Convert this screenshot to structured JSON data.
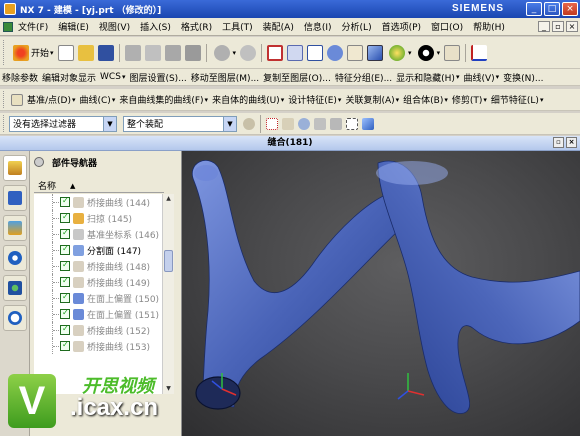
{
  "window": {
    "title": "NX 7 - 建模 - [yj.prt （修改的）]",
    "brand": "SIEMENS",
    "controls": [
      "_",
      "□",
      "×"
    ]
  },
  "menubar": {
    "items": [
      "文件(F)",
      "编辑(E)",
      "视图(V)",
      "插入(S)",
      "格式(R)",
      "工具(T)",
      "装配(A)",
      "信息(I)",
      "分析(L)",
      "首选项(P)",
      "窗口(O)",
      "帮助(H)"
    ]
  },
  "toolbar_standard": {
    "start_label": "开始",
    "icons": [
      "new-icon",
      "open-icon",
      "save-icon",
      "cut-icon",
      "copy-icon",
      "paste-icon",
      "undo-icon",
      "redo-icon",
      "fit-icon",
      "zoom-icon",
      "zoom-box-icon",
      "pan-icon",
      "rotate-icon",
      "shaded-icon",
      "material-icon",
      "display-icon",
      "wcs-icon"
    ]
  },
  "toolbar_utility": {
    "items": [
      "移除参数",
      "编辑对象显示",
      "WCS",
      "图层设置(S)...",
      "移动至图层(M)...",
      "复制至图层(O)...",
      "特征分组(E)...",
      "显示和隐藏(H)",
      "曲线(V)",
      "变换(N)..."
    ]
  },
  "toolbar_feature": {
    "items": [
      "基准/点(D)",
      "曲线(C)",
      "来自曲线集的曲线(F)",
      "来自体的曲线(U)",
      "设计特征(E)",
      "关联复制(A)",
      "组合体(B)",
      "修剪(T)",
      "细节特征(L)"
    ]
  },
  "selection_bar": {
    "filter_value": "没有选择过滤器",
    "scope_value": "整个装配"
  },
  "graphics_window": {
    "title": "缝合(181)"
  },
  "navigator": {
    "title": "部件导航器",
    "column_name": "名称",
    "rows": [
      {
        "label": "桥接曲线 (144)",
        "active": false
      },
      {
        "label": "扫掠 (145)",
        "active": false
      },
      {
        "label": "基准坐标系 (146)",
        "active": false
      },
      {
        "label": "分割面 (147)",
        "active": true
      },
      {
        "label": "桥接曲线 (148)",
        "active": false
      },
      {
        "label": "桥接曲线 (149)",
        "active": false
      },
      {
        "label": "在面上偏置 (150)",
        "active": false
      },
      {
        "label": "在面上偏置 (151)",
        "active": false
      },
      {
        "label": "桥接曲线 (152)",
        "active": false
      },
      {
        "label": "桥接曲线 (153)",
        "active": false
      }
    ]
  },
  "watermark": {
    "logo_letter": "V",
    "name": "开思视频",
    "url": ".icax.cn"
  },
  "colors": {
    "title_bar": "#1a46b0",
    "model_surface": "#4a64b8",
    "viewport_bg": "#4a4a4c",
    "check_green": "#18a018",
    "watermark_green": "#4cbc2a"
  }
}
